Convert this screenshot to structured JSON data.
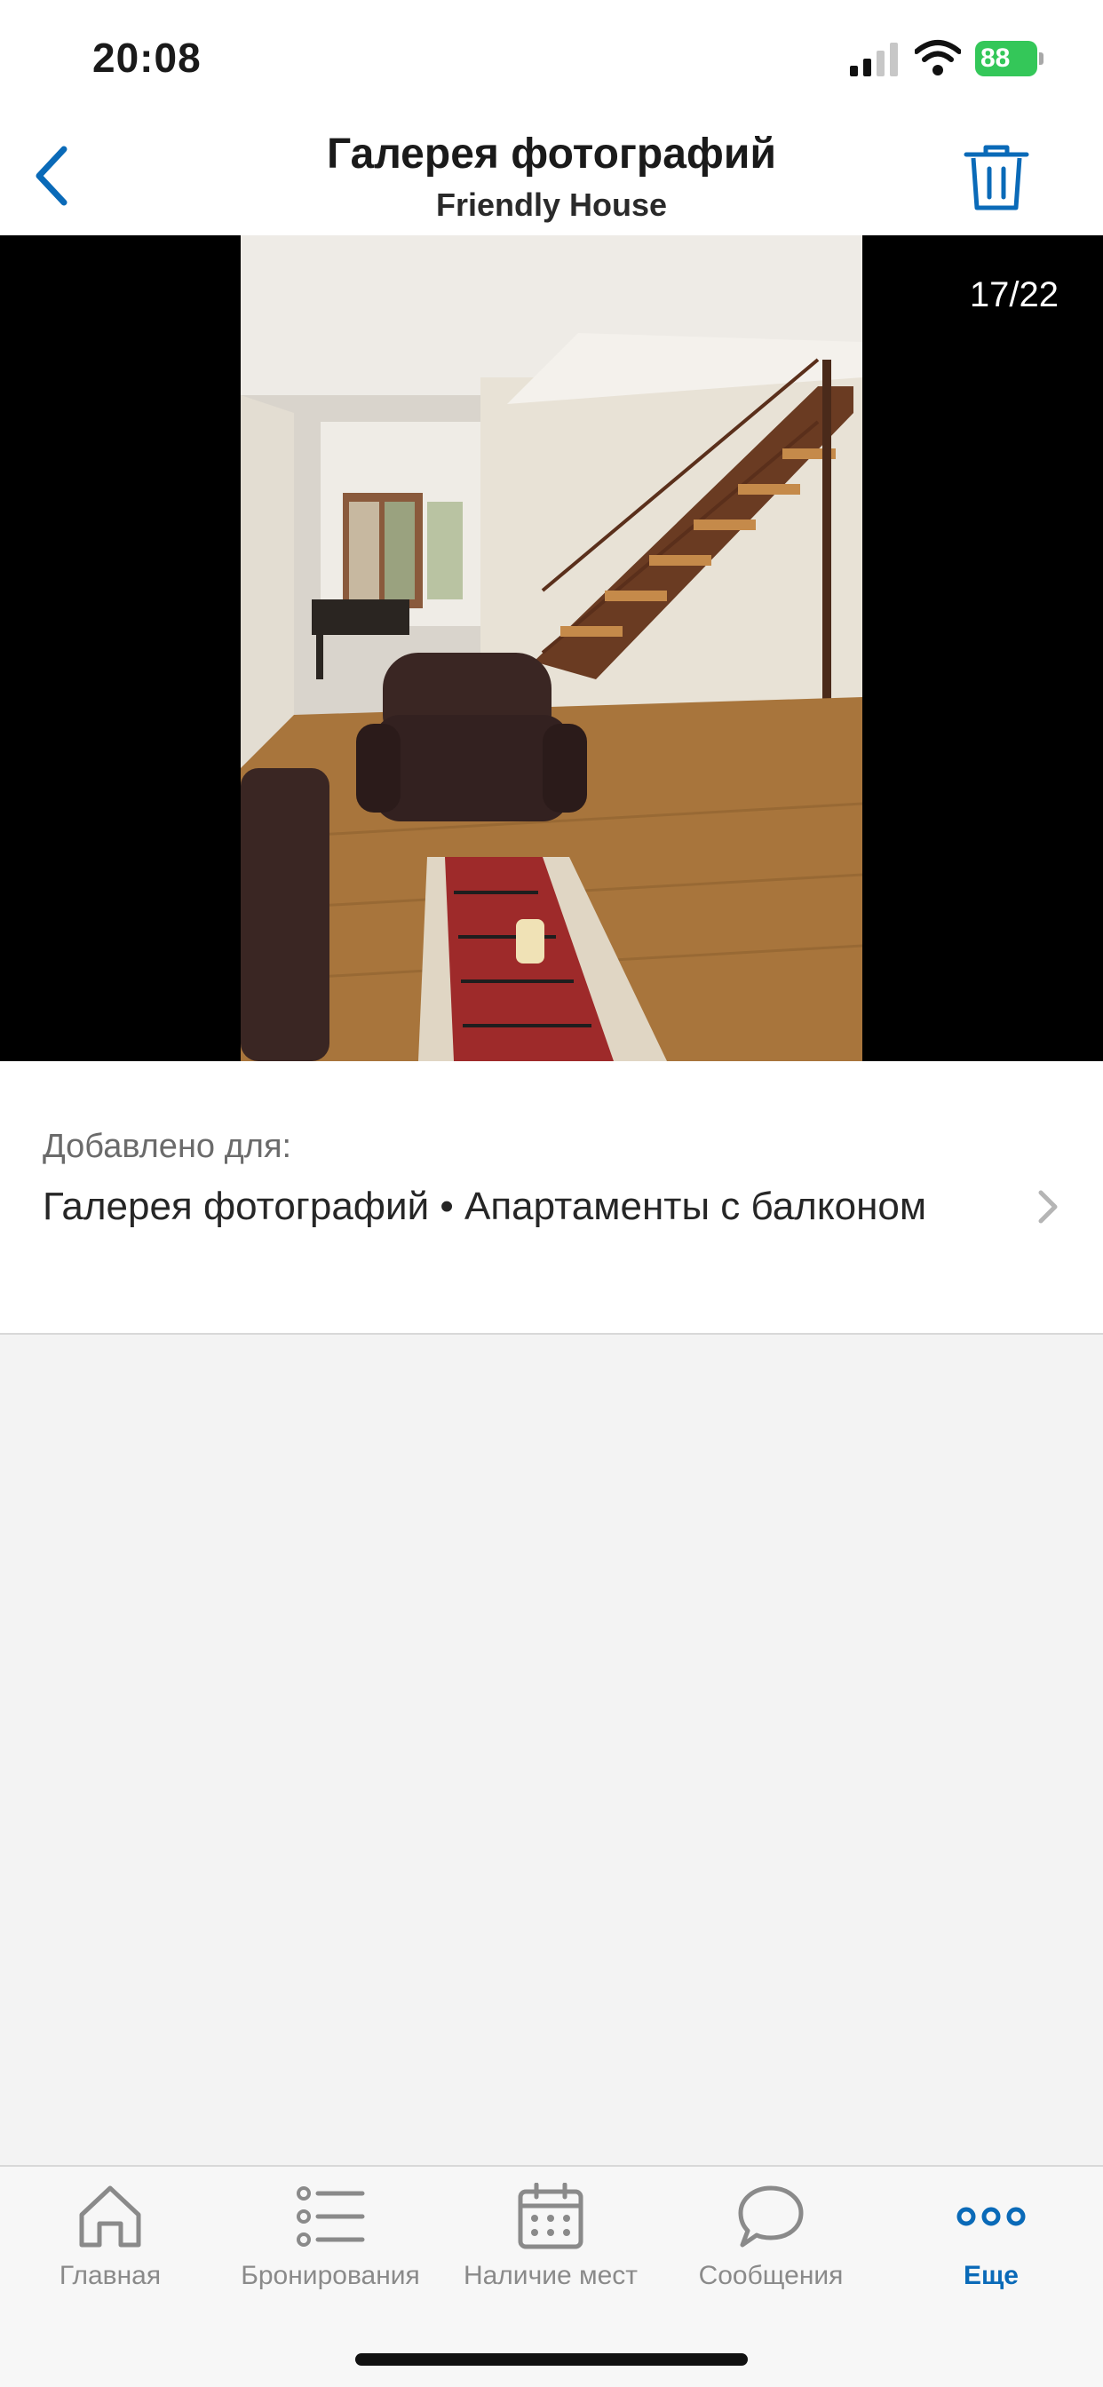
{
  "status_bar": {
    "time": "20:08",
    "battery": "88"
  },
  "header": {
    "title": "Галерея фотографий",
    "subtitle": "Friendly House",
    "back_icon": "chevron-left-icon",
    "delete_icon": "trash-icon"
  },
  "photo": {
    "counter": "17/22",
    "current_index": 17,
    "total": 22
  },
  "added_for": {
    "label": "Добавлено для:",
    "path": "Галерея фотографий • Апартаменты с балконом"
  },
  "tabs": [
    {
      "label": "Главная",
      "icon": "home-icon",
      "active": false
    },
    {
      "label": "Бронирования",
      "icon": "list-icon",
      "active": false
    },
    {
      "label": "Наличие мест",
      "icon": "calendar-icon",
      "active": false
    },
    {
      "label": "Сообщения",
      "icon": "chat-bubble-icon",
      "active": false
    },
    {
      "label": "Еще",
      "icon": "more-icon",
      "active": true
    }
  ],
  "colors": {
    "accent": "#0a6ab8",
    "battery": "#34c759",
    "tab_inactive": "#8a8a8a"
  }
}
